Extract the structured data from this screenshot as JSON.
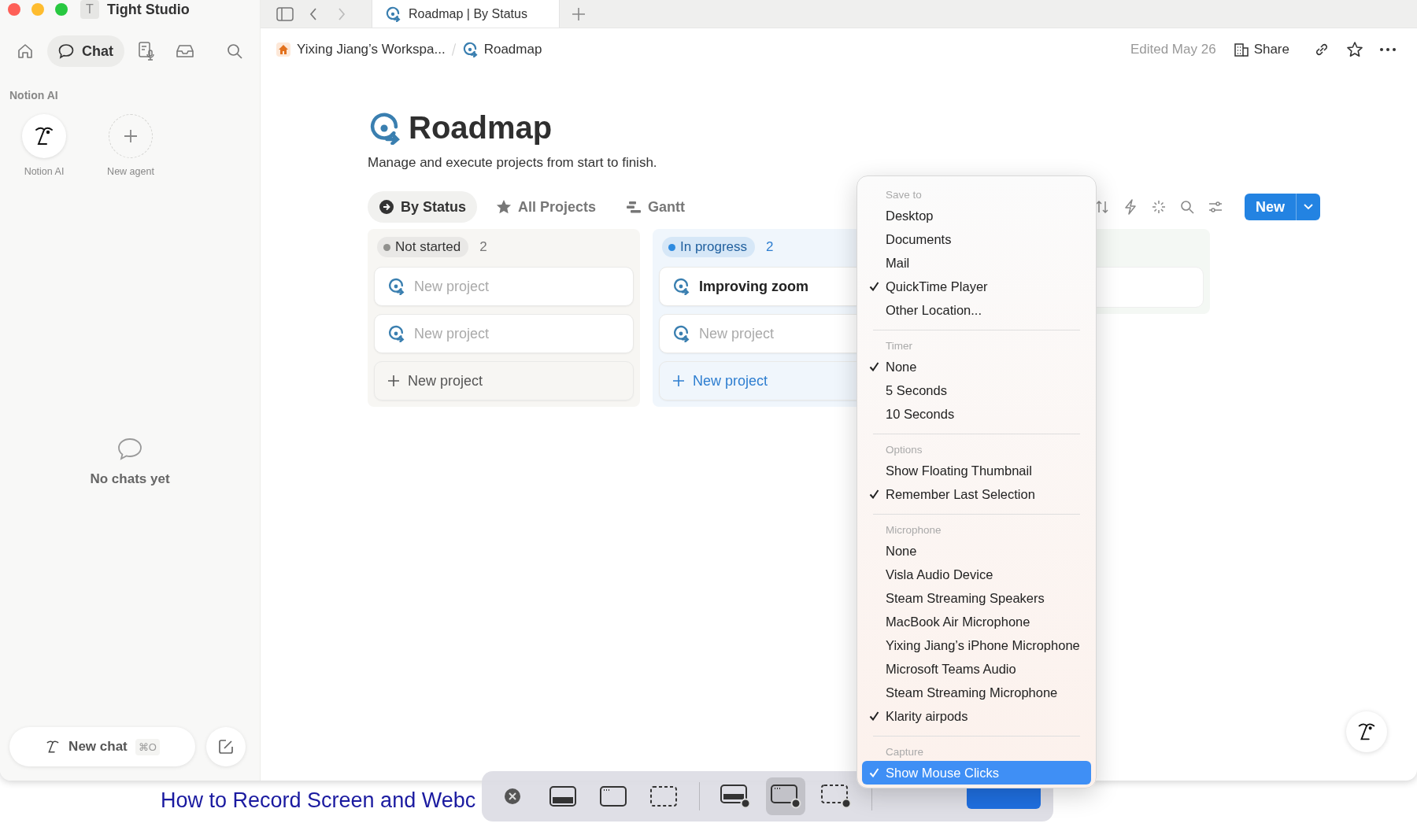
{
  "window": {
    "title": "Tight Studio",
    "initial": "T"
  },
  "sidebar": {
    "nav": [
      {
        "kind": "home",
        "selected": false
      },
      {
        "kind": "chat",
        "label": "Chat",
        "selected": true
      },
      {
        "kind": "notes",
        "selected": false
      },
      {
        "kind": "inbox",
        "selected": false
      }
    ],
    "section_title": "Notion AI",
    "agents": [
      {
        "kind": "agent",
        "label": "Notion AI"
      },
      {
        "kind": "add",
        "label": "New agent"
      }
    ],
    "empty_state": "No chats yet",
    "new_chat": {
      "label": "New chat",
      "shortcut": "⌘O"
    }
  },
  "tabs": [
    {
      "label": "Roadmap | By Status",
      "selected": true
    }
  ],
  "breadcrumb": [
    {
      "kind": "workspace",
      "label": "Yixing Jiang’s Workspa..."
    },
    {
      "kind": "page",
      "label": "Roadmap"
    }
  ],
  "edited": "Edited May 26",
  "share": "Share",
  "page": {
    "title": "Roadmap",
    "description": "Manage and execute projects from start to finish."
  },
  "views": [
    {
      "kind": "status",
      "label": "By Status",
      "selected": true
    },
    {
      "kind": "star",
      "label": "All Projects",
      "selected": false
    },
    {
      "kind": "gantt",
      "label": "Gantt",
      "selected": false
    }
  ],
  "new_button": "New",
  "columns": [
    {
      "kind": "not_started",
      "status": "Not started",
      "count": "2",
      "color": "#91918e",
      "cards": [
        {
          "kind": "untitled",
          "title": "New project"
        },
        {
          "kind": "untitled",
          "title": "New project"
        }
      ],
      "add_label": "New project"
    },
    {
      "kind": "in_progress",
      "status": "In progress",
      "count": "2",
      "color": "#2e8be0",
      "cards": [
        {
          "kind": "titled",
          "title": "Improving zoom"
        },
        {
          "kind": "untitled",
          "title": "New project"
        }
      ],
      "add_label": "New project"
    }
  ],
  "menu": {
    "sections": [
      {
        "title": "Save to",
        "items": [
          {
            "label": "Desktop",
            "checked": false,
            "selected": false
          },
          {
            "label": "Documents",
            "checked": false,
            "selected": false
          },
          {
            "label": "Mail",
            "checked": false,
            "selected": false
          },
          {
            "label": "QuickTime Player",
            "checked": true,
            "selected": false
          },
          {
            "label": "Other Location...",
            "checked": false,
            "selected": false
          }
        ]
      },
      {
        "title": "Timer",
        "items": [
          {
            "label": "None",
            "checked": true,
            "selected": false
          },
          {
            "label": "5 Seconds",
            "checked": false,
            "selected": false
          },
          {
            "label": "10 Seconds",
            "checked": false,
            "selected": false
          }
        ]
      },
      {
        "title": "Options",
        "items": [
          {
            "label": "Show Floating Thumbnail",
            "checked": false,
            "selected": false
          },
          {
            "label": "Remember Last Selection",
            "checked": true,
            "selected": false
          }
        ]
      },
      {
        "title": "Microphone",
        "items": [
          {
            "label": "None",
            "checked": false,
            "selected": false
          },
          {
            "label": "Visla Audio Device",
            "checked": false,
            "selected": false
          },
          {
            "label": "Steam Streaming Speakers",
            "checked": false,
            "selected": false
          },
          {
            "label": "MacBook Air Microphone",
            "checked": false,
            "selected": false
          },
          {
            "label": "Yixing Jiang’s iPhone Microphone",
            "checked": false,
            "selected": false
          },
          {
            "label": "Microsoft Teams Audio",
            "checked": false,
            "selected": false
          },
          {
            "label": "Steam Streaming Microphone",
            "checked": false,
            "selected": false
          },
          {
            "label": "Klarity airpods",
            "checked": true,
            "selected": false
          }
        ]
      },
      {
        "title": "Capture",
        "items": [
          {
            "label": "Show Mouse Clicks",
            "checked": true,
            "selected": true
          }
        ]
      }
    ]
  },
  "capture_toolbar": {
    "buttons": [
      {
        "kind": "close",
        "selected": false
      },
      {
        "kind": "screen",
        "selected": false
      },
      {
        "kind": "window",
        "selected": false
      },
      {
        "kind": "selection",
        "selected": false
      },
      {
        "kind": "record_screen",
        "selected": false
      },
      {
        "kind": "record_window",
        "selected": true
      },
      {
        "kind": "record_selection",
        "selected": false
      }
    ]
  },
  "background_page": {
    "heading": "How to Record Screen and Webc"
  }
}
